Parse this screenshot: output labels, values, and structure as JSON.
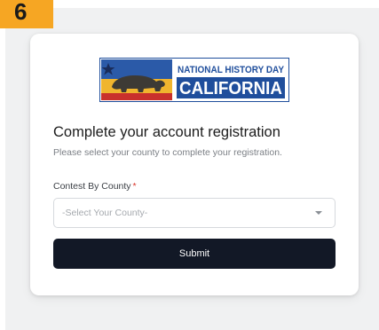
{
  "step": {
    "number": "6"
  },
  "logo": {
    "line1": "NATIONAL HISTORY DAY",
    "line2": "CALIFORNIA"
  },
  "form": {
    "heading": "Complete your account registration",
    "subtext": "Please select your county to complete your registration.",
    "county_label": "Contest By County",
    "required_mark": "*",
    "county_select": {
      "selected": "-Select Your County-"
    },
    "submit_label": "Submit"
  },
  "colors": {
    "badge": "#f6a623",
    "button": "#121826",
    "logo_blue": "#1f4e9c",
    "logo_gold": "#f0b52e",
    "required": "#d93025"
  }
}
